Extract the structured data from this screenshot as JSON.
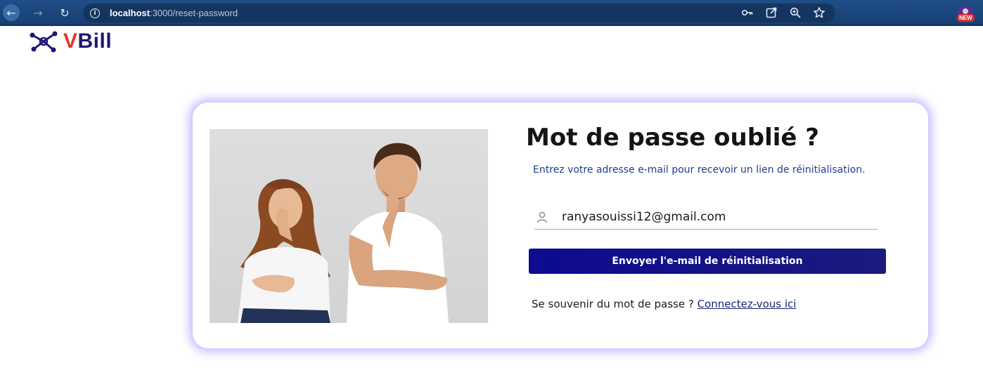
{
  "browser": {
    "url_host": "localhost",
    "url_path": ":3000/reset-password",
    "profile_badge": "NEW",
    "icons": [
      "back-arrow-icon",
      "forward-arrow-icon",
      "reload-icon",
      "site-info-icon",
      "password-key-icon",
      "open-in-app-icon",
      "zoom-icon",
      "bookmark-star-icon"
    ]
  },
  "logo": {
    "text_v": "V",
    "text_rest": "Bill"
  },
  "card": {
    "title": "Mot de passe oublié ?",
    "subtitle": "Entrez votre adresse e-mail pour recevoir un lien de réinitialisation.",
    "email_value": "ranyasouissi12@gmail.com",
    "submit_label": "Envoyer l'e-mail de réinitialisation",
    "remember_text": "Se souvenir du mot de passe ?",
    "login_link": "Connectez-vous ici"
  },
  "colors": {
    "brand_navy": "#1b1a72",
    "brand_red": "#e3362f",
    "button_primary": "#0d0b8f",
    "card_glow": "#8c82ff",
    "browser_bar": "#1f4d86"
  }
}
